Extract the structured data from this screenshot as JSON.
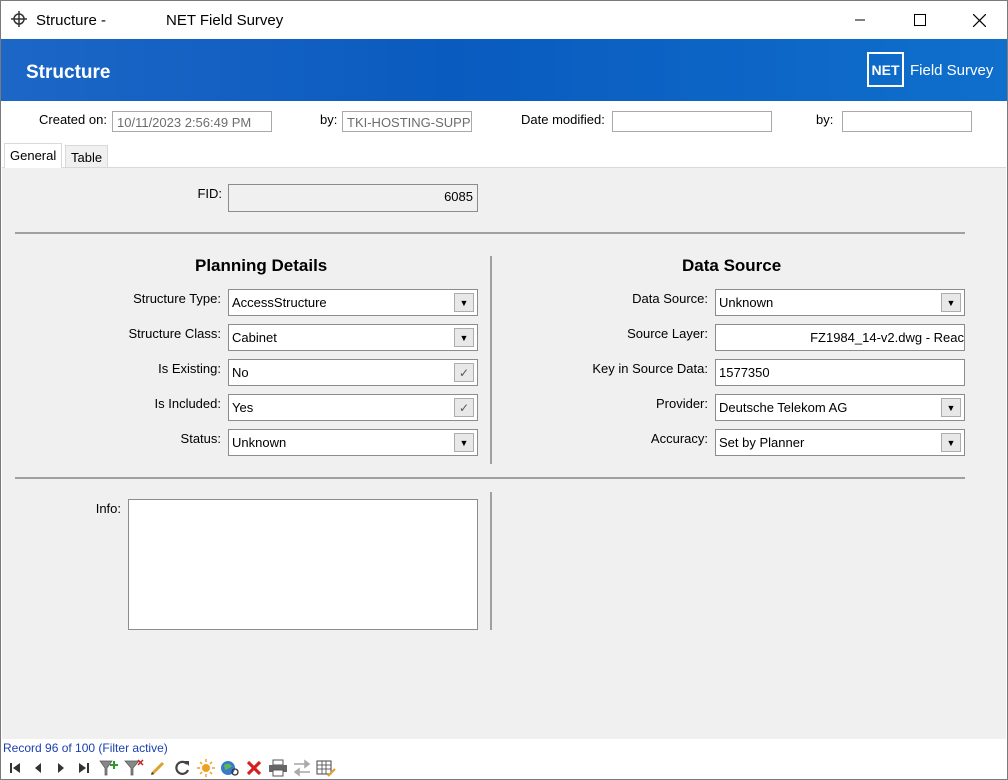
{
  "window": {
    "title": "Structure -",
    "subtitle": "NET Field Survey"
  },
  "banner": {
    "title": "Structure",
    "logo_mark": "NET",
    "logo_text": "Field Survey"
  },
  "header": {
    "created_on_label": "Created on:",
    "created_on_value": "10/11/2023 2:56:49 PM",
    "by_label": "by:",
    "by_value": "TKI-HOSTING-SUPP",
    "date_modified_label": "Date modified:",
    "date_modified_value": "",
    "by2_label": "by:",
    "by2_value": ""
  },
  "tabs": [
    {
      "label": "General",
      "active": true
    },
    {
      "label": "Table",
      "active": false
    }
  ],
  "general": {
    "fid_label": "FID:",
    "fid_value": "6085",
    "planning": {
      "title": "Planning Details",
      "structure_type_label": "Structure Type:",
      "structure_type_value": "AccessStructure",
      "structure_class_label": "Structure Class:",
      "structure_class_value": "Cabinet",
      "is_existing_label": "Is Existing:",
      "is_existing_value": "No",
      "is_included_label": "Is Included:",
      "is_included_value": "Yes",
      "status_label": "Status:",
      "status_value": "Unknown"
    },
    "data_source": {
      "title": "Data Source",
      "data_source_label": "Data Source:",
      "data_source_value": "Unknown",
      "source_layer_label": "Source Layer:",
      "source_layer_value": "FZ1984_14-v2.dwg - Reac",
      "key_label": "Key in Source Data:",
      "key_value": "1577350",
      "provider_label": "Provider:",
      "provider_value": "Deutsche Telekom AG",
      "accuracy_label": "Accuracy:",
      "accuracy_value": "Set by Planner"
    },
    "info_label": "Info:",
    "info_value": ""
  },
  "statusbar": {
    "record_text": "Record 96 of 100 (Filter active)"
  },
  "colors": {
    "banner": "#0a5bbf",
    "record_text": "#1a3fb0",
    "panel_bg": "#f0f0f0"
  },
  "icons": [
    "first-record-icon",
    "prev-record-icon",
    "next-record-icon",
    "last-record-icon",
    "add-filter-icon",
    "filter-icon",
    "edit-icon",
    "refresh-icon",
    "highlight-icon",
    "zoom-to-icon",
    "delete-icon",
    "print-icon",
    "connect-icon",
    "table-edit-icon"
  ]
}
